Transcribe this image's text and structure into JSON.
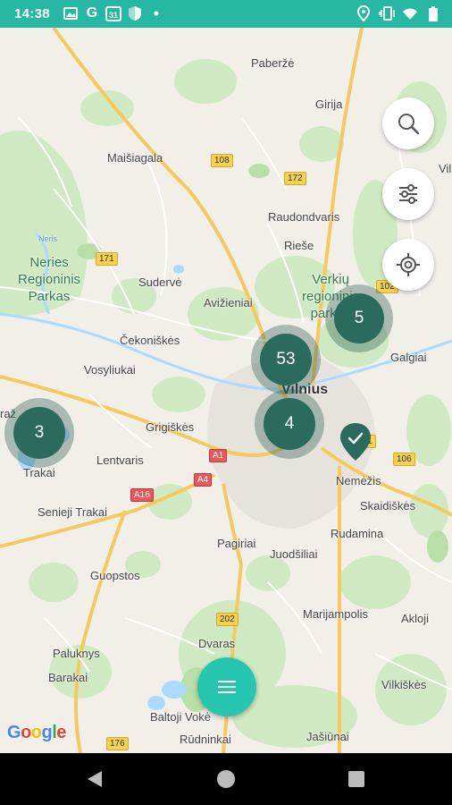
{
  "status_bar": {
    "time": "14:38",
    "left_icons": [
      "image-icon",
      "google-icon",
      "calendar-icon",
      "shield-icon",
      "dot-icon"
    ],
    "calendar_day": "31",
    "right_icons": [
      "location-icon",
      "vibrate-icon",
      "wifi-icon",
      "battery-icon"
    ]
  },
  "map": {
    "labels": {
      "paberze": "Paberžė",
      "girija": "Girija",
      "maisiagala": "Maišiagala",
      "raudondvaris": "Raudondvaris",
      "rieze": "Rieše",
      "neries_park": "Neries\nRegioninis\nParkas",
      "suderve": "Sudervė",
      "avizieniai": "Avižieniai",
      "verkiu": "Verkių\nregioninis\nparkas",
      "cekoniskes": "Čekoniškės",
      "vosyliukai": "Vosyliukai",
      "galgiai": "Galgiai",
      "vilnius": "Vilnius",
      "grigiskes": "Grigiškės",
      "lentvaris": "Lentvaris",
      "trakai": "Trakai",
      "nemezis": "Nemėžis",
      "skaidiskes": "Skaidiškės",
      "senieji_trakai": "Senieji Trakai",
      "rudamina": "Rudamina",
      "pagiriai": "Pagiriai",
      "juodsiliai": "Juodšiliai",
      "guopstos": "Guopstos",
      "marijampolis": "Marijampolis",
      "akloji": "Akloji",
      "dvaras": "Dvaras",
      "paluknys": "Paluknys",
      "barakai": "Barakai",
      "vilkiskes": "Vilkiškės",
      "baltoji_voke": "Baltoji Vokė",
      "rudninkai": "Rūdninkai",
      "jasiunai": "Jašiūnai",
      "traz": "raž",
      "vil": "Vil",
      "neris": "Neris"
    },
    "road_shields": {
      "s108": "108",
      "s172": "172",
      "s171": "171",
      "s102": "102",
      "s101": "101",
      "s106": "106",
      "sA1": "A1",
      "sA4": "A4",
      "sA16": "A16",
      "s202": "202",
      "s176": "176"
    },
    "clusters": {
      "c5": "5",
      "c53": "53",
      "c4": "4",
      "c3": "3"
    },
    "google_logo": "Google",
    "colors": {
      "accent": "#26c6b0",
      "cluster": "#2a6b5d",
      "status_bar": "#26b8a2"
    }
  },
  "controls": {
    "search_button": "search-icon",
    "filter_button": "filter-sliders-icon",
    "locate_button": "gps-locate-icon",
    "menu_button": "menu-icon"
  },
  "nav_bar": {
    "back": "back-icon",
    "home": "home-icon",
    "recents": "recents-icon"
  }
}
